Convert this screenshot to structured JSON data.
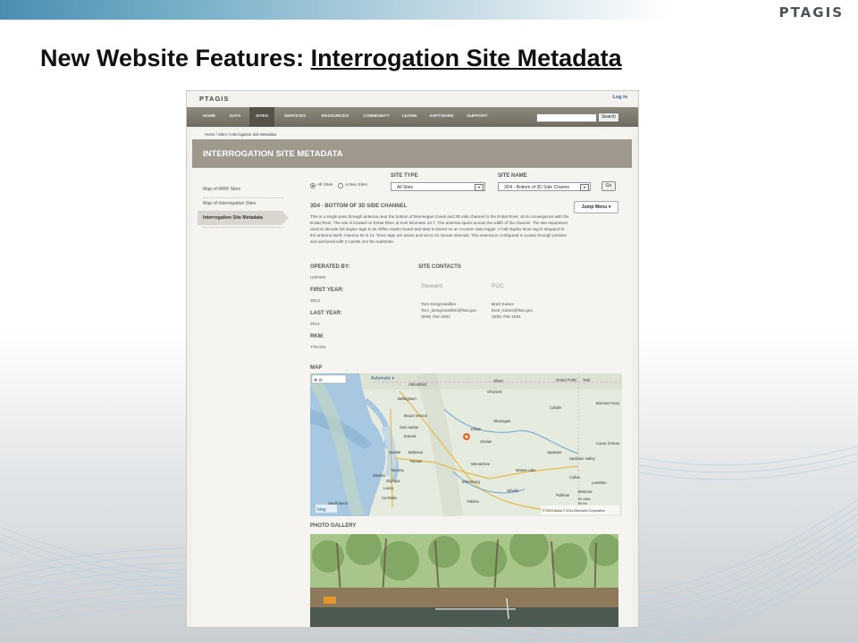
{
  "slide": {
    "logo": "PTAGIS",
    "title_prefix": "New Website Features: ",
    "title_link": "Interrogation Site Metadata"
  },
  "site": {
    "logo": "PTAGIS",
    "login": "Log in",
    "nav": [
      "HOME",
      "DATA",
      "SITES",
      "SERVICES",
      "RESOURCES",
      "COMMUNITY",
      "LEARN",
      "SOFTWARE",
      "SUPPORT"
    ],
    "nav_active": "SITES",
    "search_label": "Search",
    "breadcrumb": "Home  /  Sites  /  Interrogation Site Metadata",
    "page_title": "INTERROGATION SITE METADATA",
    "sidebar": [
      "Map of MRR Sites",
      "Map of Interrogation Sites",
      "Interrogation Site Metadata"
    ],
    "filter": {
      "all_sites": "All Sites",
      "active_sites": "Active Sites",
      "site_type_label": "SITE TYPE",
      "site_type_value": "All Sites",
      "site_name_label": "SITE NAME",
      "site_name_value": "3D4 - Bottom of 3D Side Channe",
      "go": "Go"
    },
    "jump_menu": "Jump Menu ▾",
    "site_heading": "3D4 - BOTTOM OF 3D SIDE CHANNEL",
    "description": "This is a single pass through antenna near the bottom of Brennegan Creek and 3D side channel to the Entiat River, at its convergence with the Entiat River. The site is located on Entiat River at river kilometer 42.7. The antenna spans across the width of the channel. The site equipment used to decode full duplex tags is an Allflex reader board and data is stored on an Acumen data logger. A half-duplex timer tag is strapped to the antenna itself. Antenna ID is 13. Timer tags are active and set to 31 minute intervals. The antenna is configured in a pass through position and anchored with 2 t-posts into the substrate.",
    "operated_by_label": "OPERATED BY:",
    "operated_by": "USFWS",
    "first_year_label": "FIRST YEAR:",
    "first_year": "2013",
    "last_year_label": "LAST YEAR:",
    "last_year": "2014",
    "rkm_label": "RKM:",
    "rkm": "778.043",
    "contacts_label": "SITE CONTACTS",
    "contacts": [
      {
        "role": "Steward",
        "name": "Tom Desgroseillier",
        "email": "Tom_Desgroseillier@fws.gov",
        "phone": "(509) 784-1591"
      },
      {
        "role": "POC",
        "name": "Brett Kokes",
        "email": "brett_kokes@fws.gov",
        "phone": "(509) 784-1591"
      }
    ],
    "map_label": "MAP",
    "map": {
      "mode": "Automatic ▾",
      "places": [
        "Abbotsford",
        "Oliver",
        "Grand Forks",
        "Trail",
        "Bellingham",
        "Osoyoos",
        "Mount Vernon",
        "Okanogan",
        "Colville",
        "Oak Harbor",
        "Bonners Ferry",
        "Everett",
        "Coeur d'Alene",
        "Seattle",
        "Bellevue",
        "Chelan",
        "Spokane",
        "Tacoma",
        "Renton",
        "Wenatchee",
        "Spokane Valley",
        "Olympia",
        "Ellensburg",
        "Moses Lake",
        "Pullman",
        "Moscow",
        "Yakima",
        "Othello",
        "Lacey",
        "Centralia",
        "South Bend",
        "Entiat",
        "Colfax",
        "Shelton",
        "Lewiston"
      ],
      "bing": "bing",
      "copyright": "© 2013 Nokia  © 2014 Microsoft Corporation",
      "scale": "50 miles\n50 km"
    },
    "photo_label": "PHOTO GALLERY"
  }
}
